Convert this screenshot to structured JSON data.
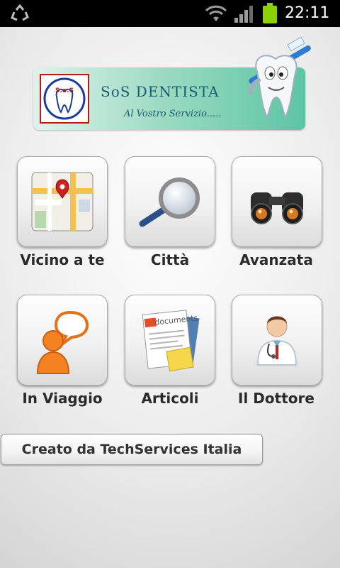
{
  "status_bar": {
    "time": "22:11",
    "icons": [
      "recycle-icon",
      "wifi-icon",
      "signal-icon",
      "battery-icon"
    ],
    "battery_color": "#8bd200"
  },
  "banner": {
    "logo_text": "S.o.S",
    "title": "SoS DENTISTA",
    "subtitle": "Al Vostro Servizio....."
  },
  "menu": [
    {
      "label": "Vicino a te",
      "icon": "map-icon"
    },
    {
      "label": "Città",
      "icon": "magnifier-icon"
    },
    {
      "label": "Avanzata",
      "icon": "binoculars-icon"
    },
    {
      "label": "In Viaggio",
      "icon": "chat-person-icon"
    },
    {
      "label": "Articoli",
      "icon": "documents-icon"
    },
    {
      "label": "Il Dottore",
      "icon": "doctor-icon"
    }
  ],
  "documents_label": "documents",
  "credit": "Creato da TechServices Italia"
}
